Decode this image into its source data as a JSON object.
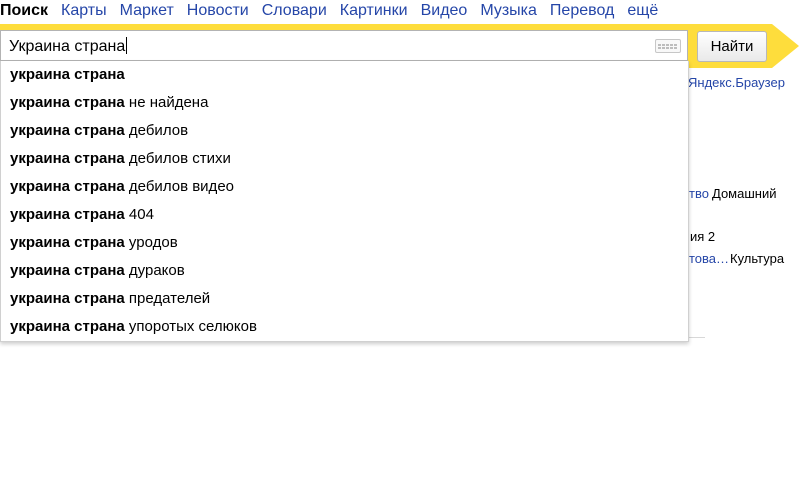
{
  "nav": {
    "items": [
      {
        "label": "Поиск",
        "active": true
      },
      {
        "label": "Карты"
      },
      {
        "label": "Маркет"
      },
      {
        "label": "Новости"
      },
      {
        "label": "Словари"
      },
      {
        "label": "Картинки"
      },
      {
        "label": "Видео"
      },
      {
        "label": "Музыка"
      },
      {
        "label": "Перевод"
      },
      {
        "label": "ещё"
      }
    ]
  },
  "search": {
    "value": "Украина страна",
    "button_label": "Найти",
    "keyboard_icon": "keyboard-icon"
  },
  "suggestions": [
    {
      "bold": "украина страна",
      "rest": ""
    },
    {
      "bold": "украина страна",
      "rest": " не найдена"
    },
    {
      "bold": "украина страна",
      "rest": " дебилов"
    },
    {
      "bold": "украина страна",
      "rest": " дебилов стихи"
    },
    {
      "bold": "украина страна",
      "rest": " дебилов видео"
    },
    {
      "bold": "украина страна",
      "rest": " 404"
    },
    {
      "bold": "украина страна",
      "rest": " уродов"
    },
    {
      "bold": "украина страна",
      "rest": " дураков"
    },
    {
      "bold": "украина страна",
      "rest": " предателей"
    },
    {
      "bold": "украина страна",
      "rest": " упоротых селюков"
    }
  ],
  "background": {
    "browser_link": "Яндекс.Браузер",
    "frag_1_link": "тво",
    "frag_1_text": "Домашний",
    "frag_2_text": "ия 2",
    "frag_3_link": "това…",
    "frag_3_text": "Культура"
  },
  "colors": {
    "brand_yellow": "#fedd3c",
    "link": "#2546a8"
  }
}
